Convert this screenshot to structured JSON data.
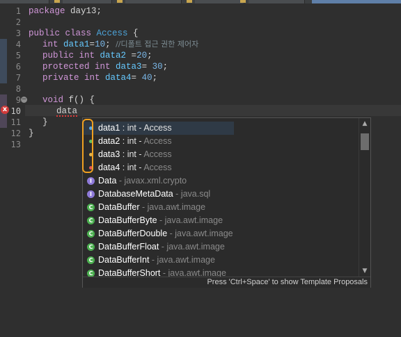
{
  "editor": {
    "line_numbers": [
      "1",
      "2",
      "3",
      "4",
      "5",
      "6",
      "7",
      "8",
      "9",
      "10",
      "11",
      "12",
      "13"
    ],
    "lines": {
      "l1": {
        "kw": "package",
        "rest": " day13;"
      },
      "l3": {
        "kw": "public class",
        "cls": "Access",
        "rest": " {"
      },
      "l4": {
        "kw": "int",
        "fld": "data1",
        "eq": "=",
        "num": "10",
        "semi": "; ",
        "cmt": "//디폴트 접근 권한 제어자"
      },
      "l5": {
        "kw": "public int",
        "fld": "data2",
        "eq": " =",
        "num": "20",
        "semi": ";"
      },
      "l6": {
        "kw": "protected int",
        "fld": "data3",
        "eq": "= ",
        "num": "30",
        "semi": ";"
      },
      "l7": {
        "kw": "private int",
        "fld": "data4",
        "eq": "= ",
        "num": "40",
        "semi": ";"
      },
      "l9": {
        "kw": "void",
        "rest": " f() {"
      },
      "l10": {
        "text": "data"
      },
      "l11": {
        "text": "}"
      },
      "l12": {
        "text": "}"
      }
    }
  },
  "popup": {
    "items": [
      {
        "name": "data1",
        "type": " : int - ",
        "pkg": "Access",
        "icon": "default-field-icon"
      },
      {
        "name": "data2",
        "type": " : int - ",
        "pkg": "Access",
        "icon": "public-field-icon"
      },
      {
        "name": "data3",
        "type": " : int - ",
        "pkg": "Access",
        "icon": "protected-field-icon"
      },
      {
        "name": "data4",
        "type": " : int - ",
        "pkg": "Access",
        "icon": "private-field-icon"
      },
      {
        "name": "Data",
        "type": " - ",
        "pkg": "javax.xml.crypto",
        "icon": "interface-icon",
        "glyph": "I"
      },
      {
        "name": "DatabaseMetaData",
        "type": " - ",
        "pkg": "java.sql",
        "icon": "interface-icon",
        "glyph": "I"
      },
      {
        "name": "DataBuffer",
        "type": " - ",
        "pkg": "java.awt.image",
        "icon": "abstract-class-icon",
        "glyph": "C"
      },
      {
        "name": "DataBufferByte",
        "type": " - ",
        "pkg": "java.awt.image",
        "icon": "class-icon",
        "glyph": "C"
      },
      {
        "name": "DataBufferDouble",
        "type": " - ",
        "pkg": "java.awt.image",
        "icon": "class-icon",
        "glyph": "C"
      },
      {
        "name": "DataBufferFloat",
        "type": " - ",
        "pkg": "java.awt.image",
        "icon": "class-icon",
        "glyph": "C"
      },
      {
        "name": "DataBufferInt",
        "type": " - ",
        "pkg": "java.awt.image",
        "icon": "class-icon",
        "glyph": "C"
      },
      {
        "name": "DataBufferShort",
        "type": " - ",
        "pkg": "java.awt.image",
        "icon": "class-icon",
        "glyph": "C"
      }
    ],
    "footer": "Press 'Ctrl+Space' to show Template Proposals"
  },
  "colors": {
    "highlight_box": "#f0a020",
    "error": "#d23a3a"
  }
}
